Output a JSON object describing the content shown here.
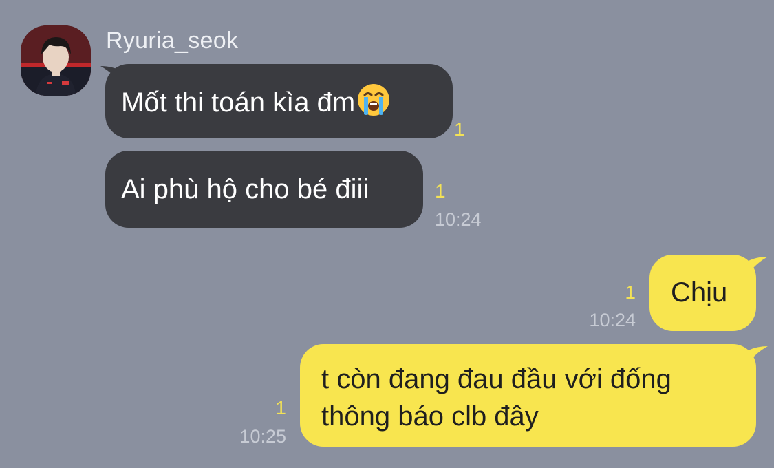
{
  "sender": {
    "name": "Ryuria_seok",
    "avatar_icon": "profile-photo-icon"
  },
  "messages": [
    {
      "direction": "incoming",
      "text": "Mốt thi toán kìa đm",
      "emoji": "loudly-crying-face-icon",
      "read_count": "1",
      "time": ""
    },
    {
      "direction": "incoming",
      "text": "Ai phù hộ cho bé điii",
      "read_count": "1",
      "time": "10:24"
    },
    {
      "direction": "outgoing",
      "text": "Chịu",
      "read_count": "1",
      "time": "10:24"
    },
    {
      "direction": "outgoing",
      "lines": [
        "t còn đang đau đầu với đống",
        "thông báo clb đây"
      ],
      "read_count": "1",
      "time": "10:25"
    }
  ],
  "colors": {
    "background": "#8a909f",
    "incoming_bubble": "#3a3b40",
    "outgoing_bubble": "#f8e54f",
    "read_count": "#f3e256",
    "timestamp": "#c7cbd4"
  }
}
